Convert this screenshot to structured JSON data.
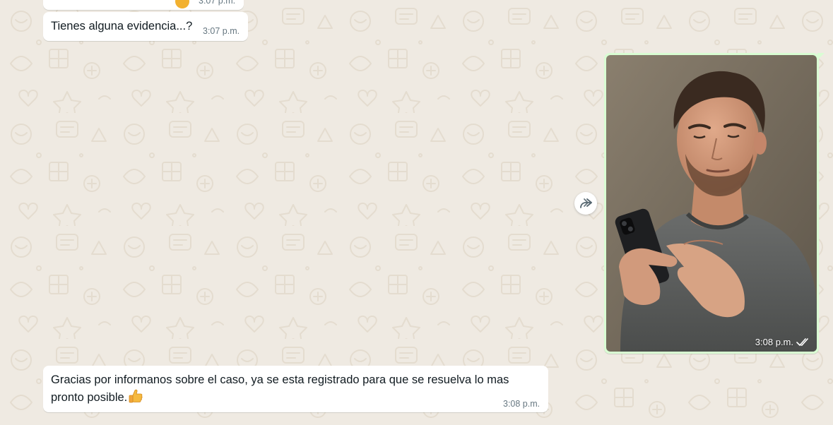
{
  "chat": {
    "messages": [
      {
        "direction": "incoming",
        "text": "",
        "time": "3:07 p.m.",
        "partially_visible": true
      },
      {
        "direction": "incoming",
        "text": "Tienes alguna evidencia...?",
        "time": "3:07 p.m."
      },
      {
        "direction": "outgoing",
        "type": "image",
        "time": "3:08 p.m.",
        "status": "double-check-icon"
      },
      {
        "direction": "incoming",
        "text": "Gracias por informanos sobre el caso, ya se esta registrado para que se resuelva lo mas pronto posible.",
        "emoji": "thumbs-up",
        "time": "3:08 p.m."
      }
    ],
    "forward_icon": "forward-icon"
  },
  "colors": {
    "background": "#efeae2",
    "incoming_bubble": "#ffffff",
    "outgoing_bubble": "#d9fdd3",
    "timestamp": "#667781",
    "text": "#111b21"
  }
}
